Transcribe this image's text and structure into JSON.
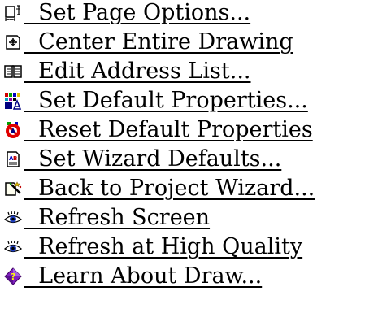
{
  "menu": {
    "items": [
      {
        "label": "  Set Page Options...",
        "icon": "page-options-icon"
      },
      {
        "label": "  Center Entire Drawing",
        "icon": "center-drawing-icon"
      },
      {
        "label": "  Edit Address List...",
        "icon": "address-book-icon"
      },
      {
        "label": "  Set Default Properties...",
        "icon": "default-properties-icon"
      },
      {
        "label": "  Reset Default Properties",
        "icon": "reset-properties-icon"
      },
      {
        "label": "  Set Wizard Defaults...",
        "icon": "wizard-defaults-icon"
      },
      {
        "label": "  Back to Project Wizard...",
        "icon": "project-wizard-icon"
      },
      {
        "label": "  Refresh Screen",
        "icon": "eye-icon"
      },
      {
        "label": "  Refresh at High Quality",
        "icon": "eye-icon"
      },
      {
        "label": "  Learn About Draw...",
        "icon": "help-diamond-icon"
      }
    ]
  }
}
